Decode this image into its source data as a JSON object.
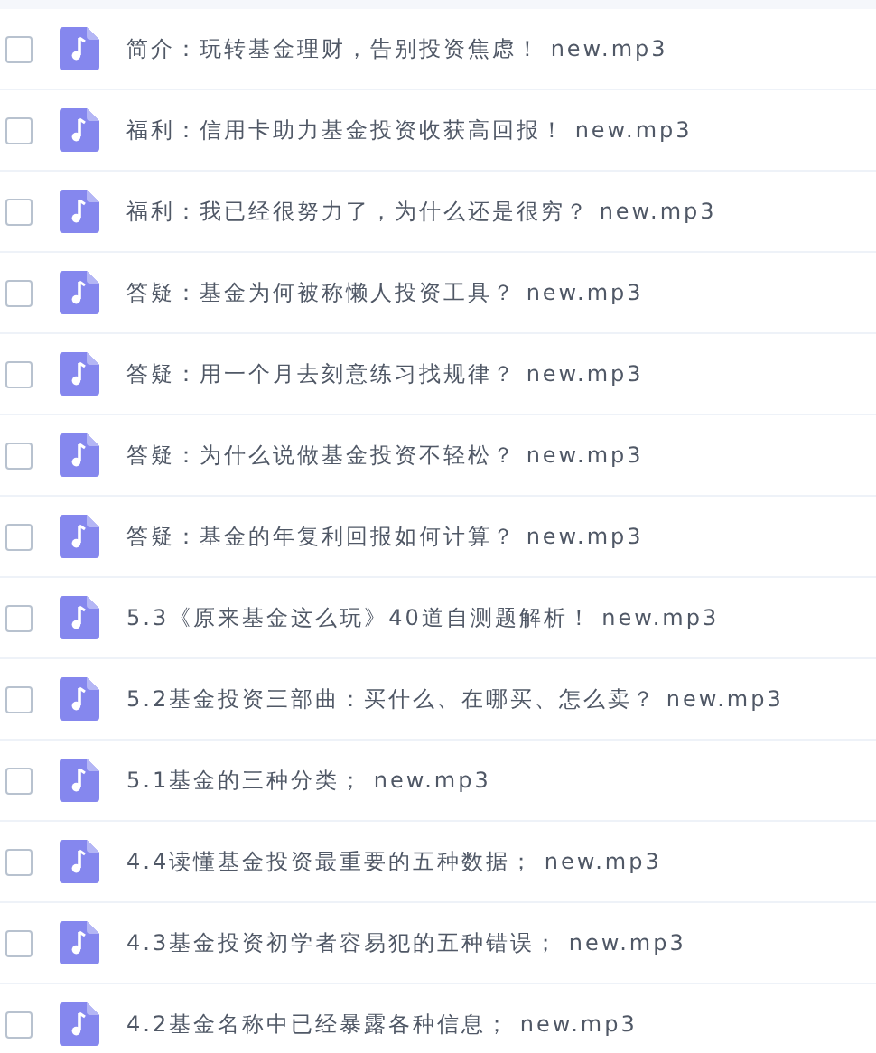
{
  "files": [
    {
      "name": "简介：玩转基金理财，告别投资焦虑！ new.mp3",
      "checked": false
    },
    {
      "name": "福利：信用卡助力基金投资收获高回报！ new.mp3",
      "checked": false
    },
    {
      "name": "福利：我已经很努力了，为什么还是很穷？ new.mp3",
      "checked": false
    },
    {
      "name": "答疑：基金为何被称懒人投资工具？ new.mp3",
      "checked": false
    },
    {
      "name": "答疑：用一个月去刻意练习找规律？ new.mp3",
      "checked": false
    },
    {
      "name": "答疑：为什么说做基金投资不轻松？ new.mp3",
      "checked": false
    },
    {
      "name": "答疑：基金的年复利回报如何计算？ new.mp3",
      "checked": false
    },
    {
      "name": "5.3《原来基金这么玩》40道自测题解析！ new.mp3",
      "checked": false
    },
    {
      "name": "5.2基金投资三部曲：买什么、在哪买、怎么卖？ new.mp3",
      "checked": false
    },
    {
      "name": "5.1基金的三种分类； new.mp3",
      "checked": false
    },
    {
      "name": "4.4读懂基金投资最重要的五种数据； new.mp3",
      "checked": false
    },
    {
      "name": "4.3基金投资初学者容易犯的五种错误； new.mp3",
      "checked": false
    },
    {
      "name": "4.2基金名称中已经暴露各种信息； new.mp3",
      "checked": false
    }
  ]
}
